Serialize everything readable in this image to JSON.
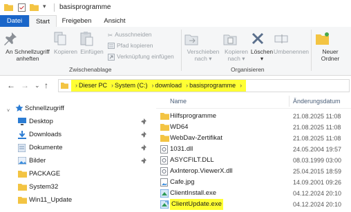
{
  "window": {
    "title": "basisprogramme"
  },
  "ribbon_tabs": [
    "Datei",
    "Start",
    "Freigeben",
    "Ansicht"
  ],
  "ribbon": {
    "clipboard": {
      "pin_label_1": "An Schnellzugriff",
      "pin_label_2": "anheften",
      "copy_label": "Kopieren",
      "paste_label": "Einfügen",
      "cut_label": "Ausschneiden",
      "copy_path_label": "Pfad kopieren",
      "paste_shortcut_label": "Verknüpfung einfügen",
      "group_label": "Zwischenablage"
    },
    "organize": {
      "move_label_1": "Verschieben",
      "move_label_2": "nach",
      "copyto_label_1": "Kopieren",
      "copyto_label_2": "nach",
      "delete_label": "Löschen",
      "rename_label": "Umbenennen",
      "group_label": "Organisieren"
    },
    "new": {
      "newfolder_label_1": "Neuer",
      "newfolder_label_2": "Ordner"
    }
  },
  "address": {
    "crumbs": [
      "Dieser PC",
      "System (C:)",
      "download",
      "basisprogramme"
    ]
  },
  "navpane": {
    "quick_access": "Schnellzugriff",
    "items": [
      {
        "label": "Desktop",
        "icon": "desktop-icon",
        "pinned": true
      },
      {
        "label": "Downloads",
        "icon": "download-icon",
        "pinned": true
      },
      {
        "label": "Dokumente",
        "icon": "documents-icon",
        "pinned": true
      },
      {
        "label": "Bilder",
        "icon": "pictures-icon",
        "pinned": true
      },
      {
        "label": "PACKAGE",
        "icon": "folder-icon",
        "pinned": false
      },
      {
        "label": "System32",
        "icon": "folder-icon",
        "pinned": false
      },
      {
        "label": "Win11_Update",
        "icon": "folder-icon",
        "pinned": false
      }
    ]
  },
  "filelist": {
    "col_name": "Name",
    "col_date": "Änderungsdatum",
    "rows": [
      {
        "name": "Hilfsprogramme",
        "date": "21.08.2025 11:08",
        "icon": "folder-icon"
      },
      {
        "name": "WD64",
        "date": "21.08.2025 11:08",
        "icon": "folder-icon"
      },
      {
        "name": "WebDav-Zertifikat",
        "date": "21.08.2025 11:08",
        "icon": "folder-icon"
      },
      {
        "name": "1031.dll",
        "date": "24.05.2004 19:57",
        "icon": "dll-icon"
      },
      {
        "name": "ASYCFILT.DLL",
        "date": "08.03.1999 03:00",
        "icon": "dll-icon"
      },
      {
        "name": "AxInterop.ViewerX.dll",
        "date": "25.04.2015 18:59",
        "icon": "dll-icon"
      },
      {
        "name": "Cafe.jpg",
        "date": "14.09.2001 09:26",
        "icon": "image-icon"
      },
      {
        "name": "ClientInstall.exe",
        "date": "04.12.2024 20:10",
        "icon": "exe-icon"
      },
      {
        "name": "ClientUpdate.exe",
        "date": "04.12.2024 20:10",
        "icon": "exe-update-icon"
      }
    ]
  },
  "colors": {
    "accent": "#1a66c9",
    "highlight": "#ffff33",
    "folder": "#f3c443"
  }
}
